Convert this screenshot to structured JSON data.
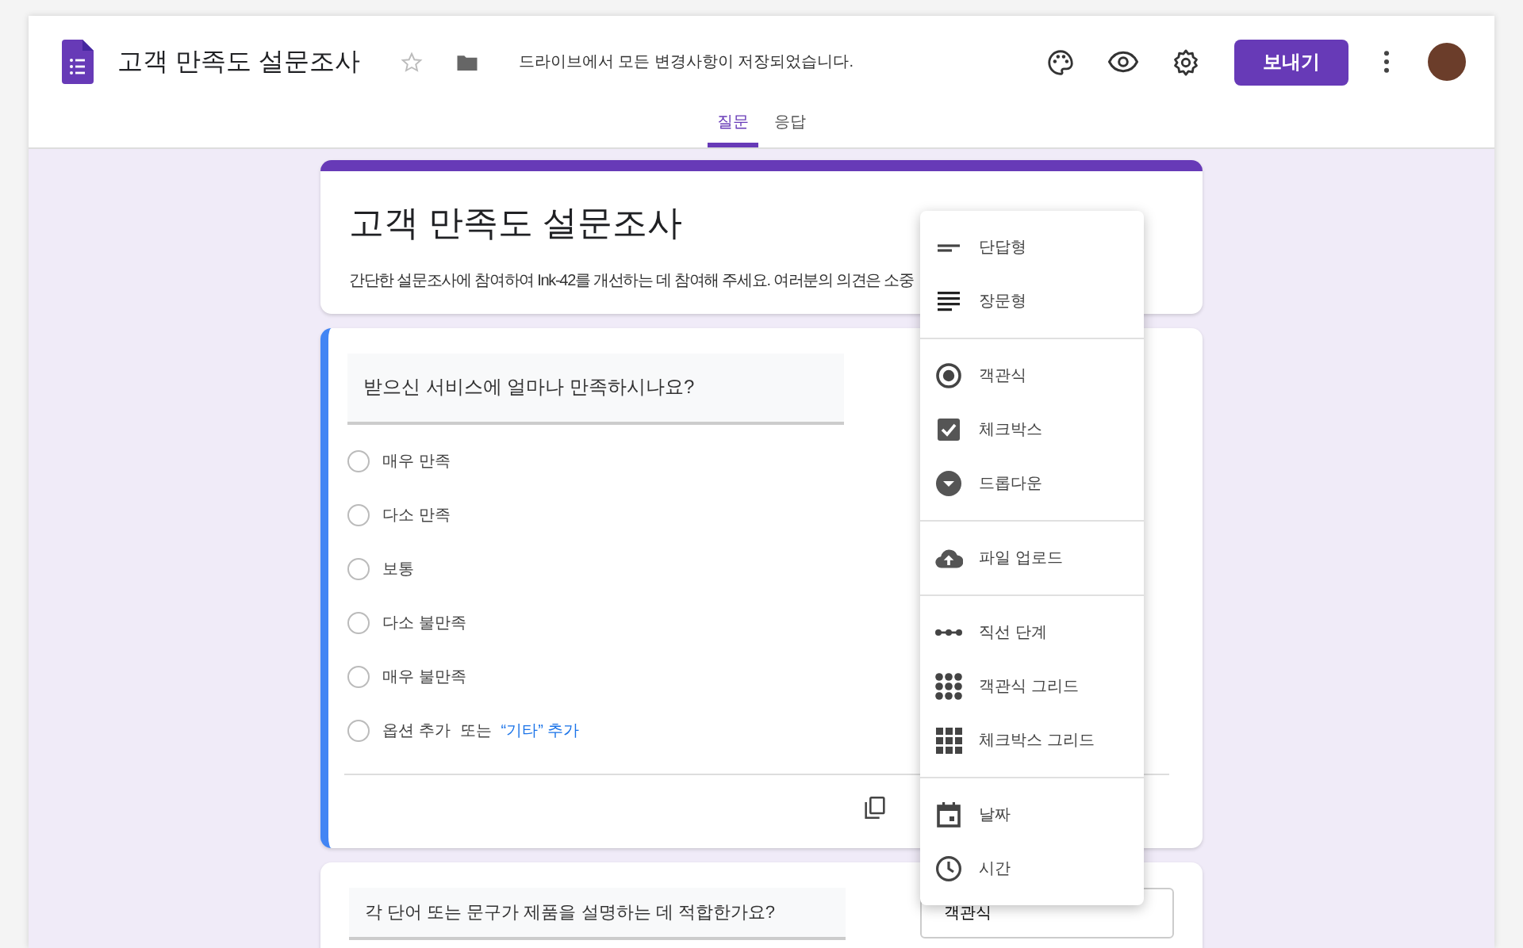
{
  "header": {
    "title": "고객 만족도 설문조사",
    "save_status": "드라이브에서 모든 변경사항이 저장되었습니다.",
    "send_button": "보내기"
  },
  "tabs": [
    {
      "label": "질문",
      "selected": true
    },
    {
      "label": "응답",
      "selected": false
    }
  ],
  "form_header": {
    "title": "고객 만족도 설문조사",
    "description": "간단한 설문조사에 참여하여 Ink-42를 개선하는 데 참여해 주세요. 여러분의 의견은 소중"
  },
  "question": {
    "text": "받으신 서비스에 얼마나 만족하시나요?",
    "options": [
      {
        "label": "매우 만족",
        "checked": false
      },
      {
        "label": "다소 만족",
        "checked": false
      },
      {
        "label": "보통",
        "checked": false
      },
      {
        "label": "다소 불만족",
        "checked": false
      },
      {
        "label": "매우 불만족",
        "checked": false
      }
    ],
    "add_row": {
      "checked": false,
      "label": "옵션 추가",
      "or": "또는",
      "link": "“기타” 추가"
    }
  },
  "next_question": {
    "text": "각 단어 또는 문구가 제품을 설명하는 데 적합한가요?",
    "type": "객관식"
  },
  "type_menu": {
    "groups": [
      [
        {
          "kind": "short",
          "label": "단답형"
        },
        {
          "kind": "paragraph",
          "label": "장문형"
        }
      ],
      [
        {
          "kind": "radio",
          "label": "객관식"
        },
        {
          "kind": "checkbox",
          "label": "체크박스"
        },
        {
          "kind": "dropdown",
          "label": "드롭다운"
        }
      ],
      [
        {
          "kind": "upload",
          "label": "파일 업로드"
        }
      ],
      [
        {
          "kind": "scale",
          "label": "직선 단계"
        },
        {
          "kind": "radio-grid",
          "label": "객관식 그리드"
        },
        {
          "kind": "checkbox-grid",
          "label": "체크박스 그리드"
        }
      ],
      [
        {
          "kind": "date",
          "label": "날짜"
        },
        {
          "kind": "time",
          "label": "시간"
        }
      ]
    ]
  }
}
